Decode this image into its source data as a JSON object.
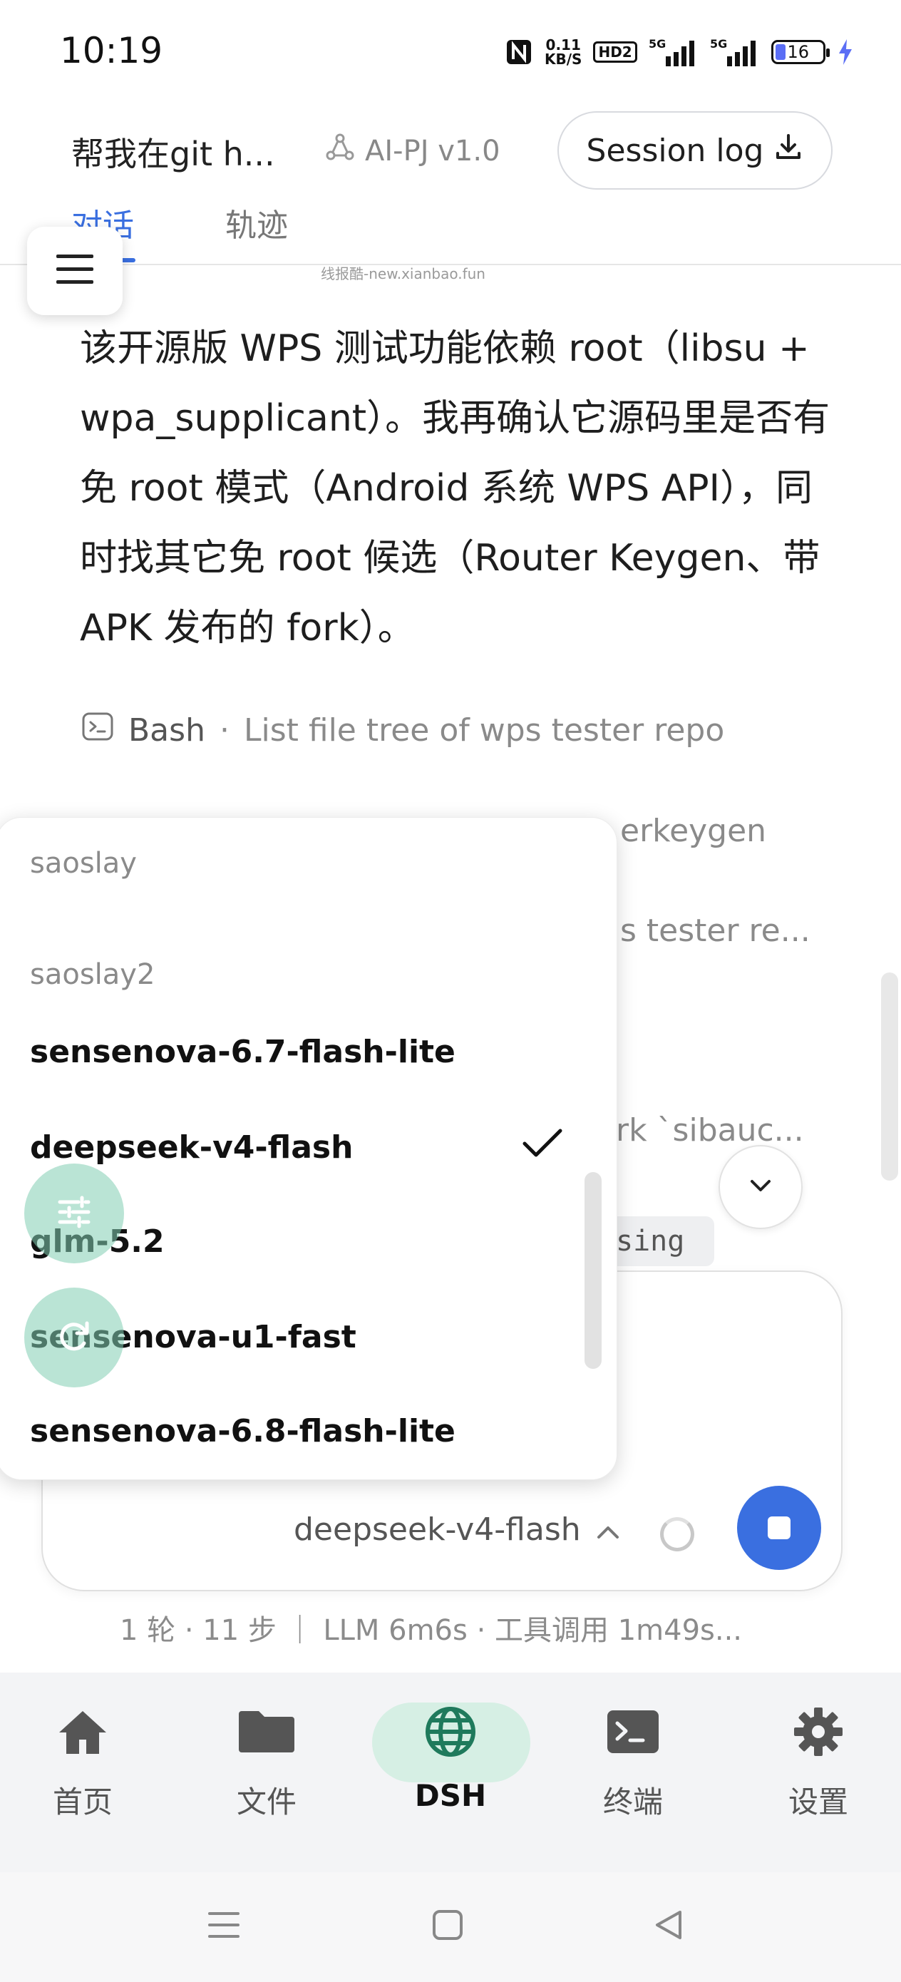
{
  "status_bar": {
    "time": "10:19",
    "net_speed_value": "0.11",
    "net_speed_unit": "KB/S",
    "hd_label": "HD2",
    "signal_1_label": "5G",
    "signal_2_label": "5G",
    "battery_level": "16",
    "icons": [
      "nfc-icon",
      "hd-voice-icon",
      "signal-5g-icon",
      "signal-5g-icon",
      "battery-icon",
      "charging-bolt-icon"
    ]
  },
  "header": {
    "title": "帮我在git h...",
    "model_badge": "AI-PJ v1.0",
    "session_log_label": "Session log",
    "tabs": [
      {
        "label": "对话",
        "active": true
      },
      {
        "label": "轨迹",
        "active": false
      }
    ],
    "watermark": "线报酷-new.xianbao.fun"
  },
  "message": {
    "text": "该开源版 WPS 测试功能依赖 root（libsu + wpa_supplicant）。我再确认它源码里是否有免 root 模式（Android 系统 WPS API），同时找其它免 root 候选（Router Keygen、带 APK 发布的 fork）。"
  },
  "tool_calls": [
    {
      "name": "Bash",
      "separator": "·",
      "description": "List file tree of wps tester repo"
    }
  ],
  "partial_rows": {
    "row1": "erkeygen",
    "row2": "s tester re...",
    "row3": "rk `sibauc...",
    "code_chip": "sing"
  },
  "model_dropdown": {
    "groups": [
      {
        "label": "saoslay"
      },
      {
        "label": "saoslay2"
      }
    ],
    "items": [
      {
        "label": "sensenova-6.7-flash-lite",
        "selected": false
      },
      {
        "label": "deepseek-v4-flash",
        "selected": true
      },
      {
        "label": "glm-5.2",
        "selected": false
      },
      {
        "label": "sensenova-u1-fast",
        "selected": false
      },
      {
        "label": "sensenova-6.8-flash-lite",
        "selected": false
      }
    ]
  },
  "composer": {
    "model_label": "deepseek-v4-flash",
    "stats": "1 轮 · 11 步  ｜  LLM 6m6s · 工具调用 1m49s..."
  },
  "bottom_nav": [
    {
      "label": "首页",
      "icon": "home-icon",
      "active": false
    },
    {
      "label": "文件",
      "icon": "folder-icon",
      "active": false
    },
    {
      "label": "DSH",
      "icon": "globe-icon",
      "active": true
    },
    {
      "label": "终端",
      "icon": "terminal-icon",
      "active": false
    },
    {
      "label": "设置",
      "icon": "gear-icon",
      "active": false
    }
  ],
  "colors": {
    "accent": "#3a6fe0",
    "nav_active_bg": "#d6efe4",
    "fab_bg": "#82cdb2"
  }
}
